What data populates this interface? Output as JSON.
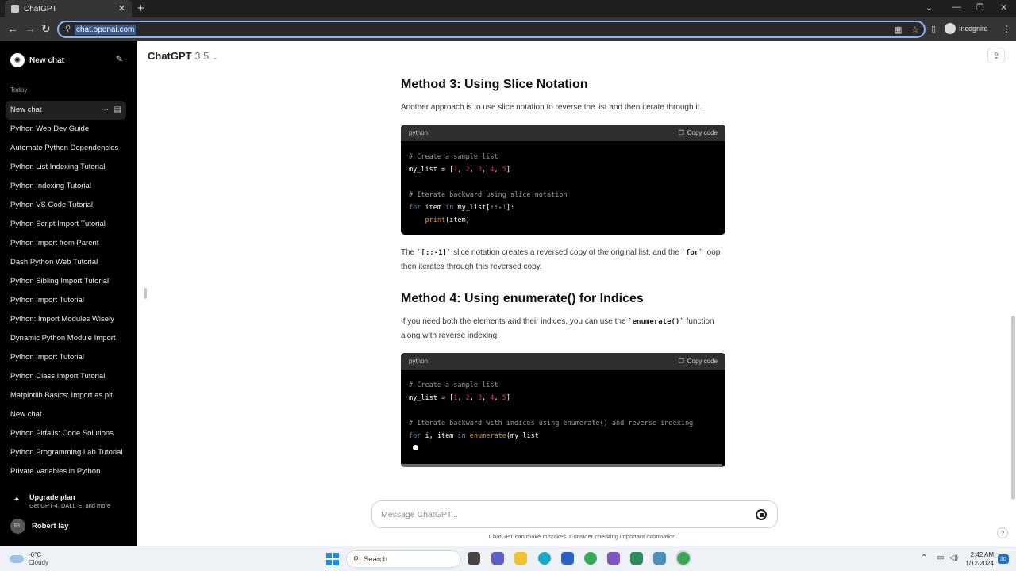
{
  "browser": {
    "tab_title": "ChatGPT",
    "url": "chat.openai.com",
    "incognito_label": "Incognito"
  },
  "sidebar": {
    "new_chat_label": "New chat",
    "section_label": "Today",
    "items": [
      {
        "label": "New chat",
        "active": true
      },
      {
        "label": "Python Web Dev Guide"
      },
      {
        "label": "Automate Python Dependencies"
      },
      {
        "label": "Python List Indexing Tutorial"
      },
      {
        "label": "Python Indexing Tutorial"
      },
      {
        "label": "Python VS Code Tutorial"
      },
      {
        "label": "Python Script Import Tutorial"
      },
      {
        "label": "Python Import from Parent"
      },
      {
        "label": "Dash Python Web Tutorial"
      },
      {
        "label": "Python Sibling Import Tutorial"
      },
      {
        "label": "Python Import Tutorial"
      },
      {
        "label": "Python: Import Modules Wisely"
      },
      {
        "label": "Dynamic Python Module Import"
      },
      {
        "label": "Python Import Tutorial"
      },
      {
        "label": "Python Class Import Tutorial"
      },
      {
        "label": "Matplotlib Basics: Import as plt"
      },
      {
        "label": "New chat"
      },
      {
        "label": "Python Pitfalls: Code Solutions"
      },
      {
        "label": "Python Programming Lab Tutorial"
      },
      {
        "label": "Private Variables in Python"
      }
    ],
    "upgrade": {
      "title": "Upgrade plan",
      "subtitle": "Get GPT-4, DALL·E, and more"
    },
    "user": {
      "initials": "RL",
      "name": "Robert lay"
    }
  },
  "header": {
    "model_name": "ChatGPT",
    "model_version": "3.5"
  },
  "content": {
    "method3": {
      "heading": "Method 3: Using Slice Notation",
      "intro": "Another approach is to use slice notation to reverse the list and then iterate through it.",
      "code_lang": "python",
      "copy_label": "Copy code",
      "explain_part1": "The ",
      "explain_code1": "`[::-1]`",
      "explain_part2": " slice notation creates a reversed copy of the original list, and the ",
      "explain_code2": "`for`",
      "explain_part3": " loop then iterates through this reversed copy."
    },
    "method4": {
      "heading": "Method 4: Using enumerate() for Indices",
      "intro_part1": "If you need both the elements and their indices, you can use the ",
      "intro_code": "`enumerate()`",
      "intro_part2": " function along with reverse indexing.",
      "code_lang": "python",
      "copy_label": "Copy code"
    }
  },
  "composer": {
    "placeholder": "Message ChatGPT..."
  },
  "disclaimer": "ChatGPT can make mistakes. Consider checking important information.",
  "taskbar": {
    "temperature": "-6°C",
    "weather": "Cloudy",
    "search_label": "Search",
    "time": "2:42 AM",
    "date": "1/12/2024",
    "notifications": "20"
  }
}
